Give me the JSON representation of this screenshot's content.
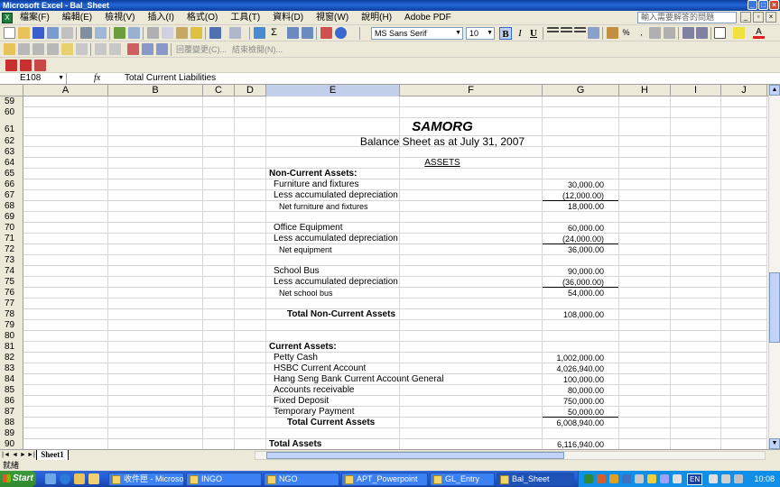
{
  "window": {
    "title": "Microsoft Excel - Bal_Sheet"
  },
  "menu": {
    "items": [
      "檔案(F)",
      "編輯(E)",
      "檢視(V)",
      "插入(I)",
      "格式(O)",
      "工具(T)",
      "資料(D)",
      "視窗(W)",
      "說明(H)",
      "Adobe PDF"
    ],
    "help_placeholder": "輸入需要解答的問題"
  },
  "toolbar": {
    "font_name": "MS Sans Serif",
    "font_size": "10",
    "bold": "B",
    "italic": "I",
    "underline": "U",
    "reply_changes": "回覆變更(C)...",
    "end_review": "結束檢閱(N)..."
  },
  "formula_bar": {
    "name_box": "E108",
    "fx": "fx",
    "value": "Total Current Liabilities"
  },
  "columns": [
    "A",
    "B",
    "C",
    "D",
    "E",
    "F",
    "G",
    "H",
    "I",
    "J"
  ],
  "selected_column": "E",
  "sheet": {
    "title": "SAMORG",
    "subtitle": "Balance Sheet as at July 31, 2007",
    "section": "ASSETS",
    "rows": [
      {
        "num": "59"
      },
      {
        "num": "60"
      },
      {
        "num": "61",
        "kind": "title"
      },
      {
        "num": "62",
        "kind": "subtitle"
      },
      {
        "num": "63"
      },
      {
        "num": "64",
        "kind": "section"
      },
      {
        "num": "65",
        "label": "Non-Current Assets:",
        "style": "head"
      },
      {
        "num": "66",
        "label": "Furniture and fixtures",
        "style": "ind1",
        "value": "30,000.00"
      },
      {
        "num": "67",
        "label": "Less accumulated depreciation",
        "style": "ind1",
        "value": "(12,000.00)"
      },
      {
        "num": "68",
        "label": "Net furniture and fixtures",
        "style": "ind2",
        "value": "18,000.00",
        "line_above": true
      },
      {
        "num": "69"
      },
      {
        "num": "70",
        "label": "Office Equipment",
        "style": "ind1",
        "value": "60,000.00"
      },
      {
        "num": "71",
        "label": "Less accumulated depreciation",
        "style": "ind1",
        "value": "(24,000.00)"
      },
      {
        "num": "72",
        "label": "Net equipment",
        "style": "ind2",
        "value": "36,000.00",
        "line_above": true
      },
      {
        "num": "73"
      },
      {
        "num": "74",
        "label": "School Bus",
        "style": "ind1",
        "value": "90,000.00"
      },
      {
        "num": "75",
        "label": "Less accumulated depreciation",
        "style": "ind1",
        "value": "(36,000.00)"
      },
      {
        "num": "76",
        "label": "Net school bus",
        "style": "ind2",
        "value": "54,000.00",
        "line_above": true
      },
      {
        "num": "77"
      },
      {
        "num": "78",
        "label": "Total Non-Current Assets",
        "style": "ind3",
        "value": "108,000.00"
      },
      {
        "num": "79"
      },
      {
        "num": "80"
      },
      {
        "num": "81",
        "label": "Current Assets:",
        "style": "head"
      },
      {
        "num": "82",
        "label": "Petty Cash",
        "style": "ind1",
        "value": "1,002,000.00"
      },
      {
        "num": "83",
        "label": "HSBC Current Account",
        "style": "ind1",
        "value": "4,026,940.00"
      },
      {
        "num": "84",
        "label": "Hang Seng Bank Current Account General",
        "style": "ind1",
        "value": "100,000.00"
      },
      {
        "num": "85",
        "label": "Accounts receivable",
        "style": "ind1",
        "value": "80,000.00"
      },
      {
        "num": "86",
        "label": "Fixed Deposit",
        "style": "ind1",
        "value": "750,000.00"
      },
      {
        "num": "87",
        "label": "Temporary Payment",
        "style": "ind1",
        "value": "50,000.00"
      },
      {
        "num": "88",
        "label": "Total Current Assets",
        "style": "ind3",
        "value": "6,008,940.00",
        "line_above": true
      },
      {
        "num": "89"
      },
      {
        "num": "90",
        "label": "Total Assets",
        "style": "head",
        "value": "6,116,940.00"
      }
    ]
  },
  "tabs": {
    "sheet_name": "Sheet1"
  },
  "status": {
    "text": "就緒"
  },
  "taskbar": {
    "start": "Start",
    "tasks": [
      "收件匣 - Microsof...",
      "INGO",
      "NGO",
      "APT_Powerpoint",
      "GL_Entry",
      "Bal_Sheet"
    ],
    "lang": "EN",
    "clock": "10:08"
  }
}
